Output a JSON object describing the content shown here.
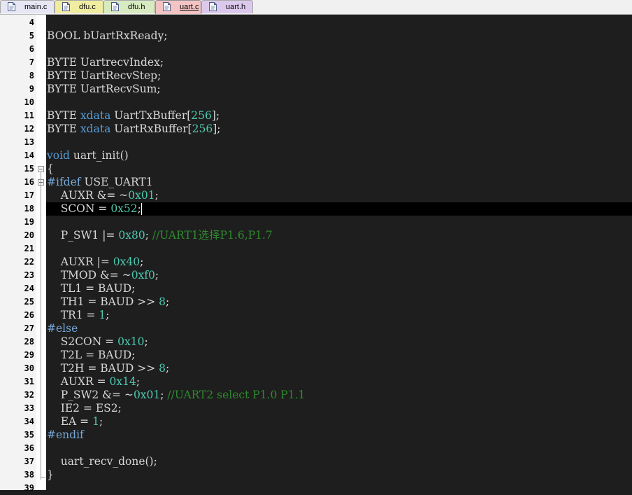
{
  "colors": {
    "editor_bg": "#1e1e1e",
    "current_line_bg": "#000000",
    "default_text": "#d8d8d8",
    "keyword": "#569cd6",
    "number": "#4ec9b0",
    "comment": "#2e8b2e",
    "preprocessor": "#76a8d8"
  },
  "tabs": [
    {
      "label": "main.c",
      "color": "#e6e6f5",
      "icon": "c-file-icon",
      "active": false
    },
    {
      "label": "dfu.c",
      "color": "#f0eca0",
      "icon": "c-file-icon",
      "active": false
    },
    {
      "label": "dfu.h",
      "color": "#d8eac0",
      "icon": "h-file-icon",
      "active": false
    },
    {
      "label": "uart.c",
      "color": "#f4c4c4",
      "icon": "c-file-icon",
      "active": true
    },
    {
      "label": "uart.h",
      "color": "#dcc8ec",
      "icon": "h-file-icon",
      "active": false
    }
  ],
  "editor": {
    "current_line": 18,
    "lines": [
      {
        "n": "4",
        "tokens": []
      },
      {
        "n": "5",
        "tokens": [
          [
            "BOOL bUartRxReady;",
            "t"
          ]
        ]
      },
      {
        "n": "6",
        "tokens": []
      },
      {
        "n": "7",
        "tokens": [
          [
            "BYTE UartrecvIndex;",
            "t"
          ]
        ]
      },
      {
        "n": "8",
        "tokens": [
          [
            "BYTE UartRecvStep;",
            "t"
          ]
        ]
      },
      {
        "n": "9",
        "tokens": [
          [
            "BYTE UartRecvSum;",
            "t"
          ]
        ]
      },
      {
        "n": "10",
        "tokens": []
      },
      {
        "n": "11",
        "tokens": [
          [
            "BYTE ",
            "t"
          ],
          [
            "xdata",
            "k"
          ],
          [
            " UartTxBuffer[",
            "t"
          ],
          [
            "256",
            "n"
          ],
          [
            "];",
            "t"
          ]
        ]
      },
      {
        "n": "12",
        "tokens": [
          [
            "BYTE ",
            "t"
          ],
          [
            "xdata",
            "k"
          ],
          [
            " UartRxBuffer[",
            "t"
          ],
          [
            "256",
            "n"
          ],
          [
            "];",
            "t"
          ]
        ]
      },
      {
        "n": "13",
        "tokens": []
      },
      {
        "n": "14",
        "tokens": [
          [
            "void",
            "k"
          ],
          [
            " uart_init()",
            "t"
          ]
        ]
      },
      {
        "n": "15",
        "tokens": [
          [
            "{",
            "t"
          ]
        ]
      },
      {
        "n": "16",
        "tokens": [
          [
            "#ifdef",
            "p"
          ],
          [
            " USE_UART1",
            "t"
          ]
        ]
      },
      {
        "n": "17",
        "tokens": [
          [
            "    AUXR &= ~",
            "t"
          ],
          [
            "0x01",
            "n"
          ],
          [
            ";",
            "t"
          ]
        ]
      },
      {
        "n": "18",
        "tokens": [
          [
            "    SCON = ",
            "t"
          ],
          [
            "0x52",
            "n"
          ],
          [
            ";",
            "t"
          ]
        ]
      },
      {
        "n": "19",
        "tokens": []
      },
      {
        "n": "20",
        "tokens": [
          [
            "    P_SW1 |= ",
            "t"
          ],
          [
            "0x80",
            "n"
          ],
          [
            "; ",
            "t"
          ],
          [
            "//UART1选择P1.6,P1.7",
            "c"
          ]
        ]
      },
      {
        "n": "21",
        "tokens": []
      },
      {
        "n": "22",
        "tokens": [
          [
            "    AUXR |= ",
            "t"
          ],
          [
            "0x40",
            "n"
          ],
          [
            ";",
            "t"
          ]
        ]
      },
      {
        "n": "23",
        "tokens": [
          [
            "    TMOD &= ~",
            "t"
          ],
          [
            "0xf0",
            "n"
          ],
          [
            ";",
            "t"
          ]
        ]
      },
      {
        "n": "24",
        "tokens": [
          [
            "    TL1 = BAUD;",
            "t"
          ]
        ]
      },
      {
        "n": "25",
        "tokens": [
          [
            "    TH1 = BAUD >> ",
            "t"
          ],
          [
            "8",
            "n"
          ],
          [
            ";",
            "t"
          ]
        ]
      },
      {
        "n": "26",
        "tokens": [
          [
            "    TR1 = ",
            "t"
          ],
          [
            "1",
            "n"
          ],
          [
            ";",
            "t"
          ]
        ]
      },
      {
        "n": "27",
        "tokens": [
          [
            "#else",
            "p"
          ]
        ]
      },
      {
        "n": "28",
        "tokens": [
          [
            "    S2CON = ",
            "t"
          ],
          [
            "0x10",
            "n"
          ],
          [
            ";",
            "t"
          ]
        ]
      },
      {
        "n": "29",
        "tokens": [
          [
            "    T2L = BAUD;",
            "t"
          ]
        ]
      },
      {
        "n": "30",
        "tokens": [
          [
            "    T2H = BAUD >> ",
            "t"
          ],
          [
            "8",
            "n"
          ],
          [
            ";",
            "t"
          ]
        ]
      },
      {
        "n": "31",
        "tokens": [
          [
            "    AUXR = ",
            "t"
          ],
          [
            "0x14",
            "n"
          ],
          [
            ";",
            "t"
          ]
        ]
      },
      {
        "n": "32",
        "tokens": [
          [
            "    P_SW2 &= ~",
            "t"
          ],
          [
            "0x01",
            "n"
          ],
          [
            "; ",
            "t"
          ],
          [
            "//UART2 select P1.0 P1.1",
            "c"
          ]
        ]
      },
      {
        "n": "33",
        "tokens": [
          [
            "    IE2 = ES2;",
            "t"
          ]
        ]
      },
      {
        "n": "34",
        "tokens": [
          [
            "    EA = ",
            "t"
          ],
          [
            "1",
            "n"
          ],
          [
            ";",
            "t"
          ]
        ]
      },
      {
        "n": "35",
        "tokens": [
          [
            "#endif",
            "p"
          ]
        ]
      },
      {
        "n": "36",
        "tokens": []
      },
      {
        "n": "37",
        "tokens": [
          [
            "    uart_recv_done();",
            "t"
          ]
        ]
      },
      {
        "n": "38",
        "tokens": [
          [
            "}",
            "t"
          ]
        ]
      },
      {
        "n": "39",
        "tokens": []
      }
    ]
  }
}
